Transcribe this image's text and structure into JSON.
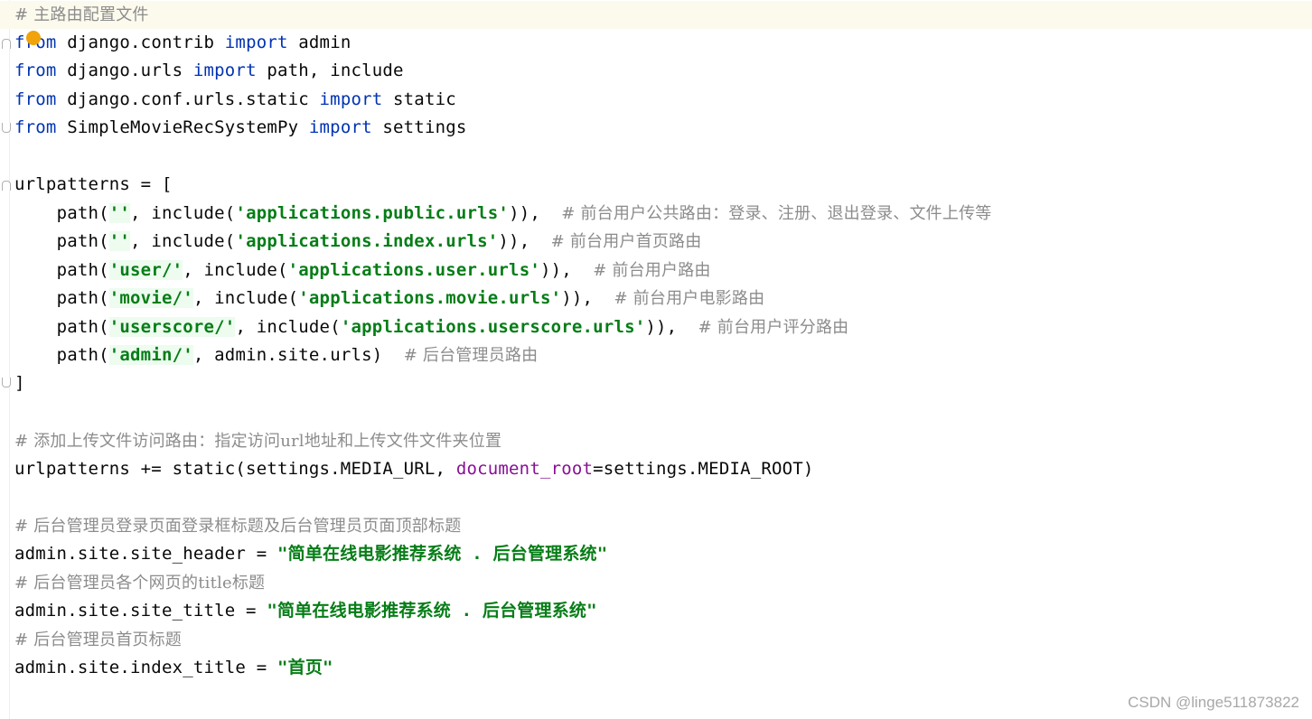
{
  "code": {
    "comment_main": "# 主路由配置文件",
    "imports": [
      {
        "from": "from",
        "module": "django.contrib",
        "import": "import",
        "names": "admin"
      },
      {
        "from": "from",
        "module": "django.urls",
        "import": "import",
        "names": "path, include"
      },
      {
        "from": "from",
        "module": "django.conf.urls.static",
        "import": "import",
        "names": "static"
      },
      {
        "from": "from",
        "module": "SimpleMovieRecSystemPy",
        "import": "import",
        "names": "settings"
      }
    ],
    "urlpatterns_open": "urlpatterns = [",
    "routes": [
      {
        "pre": "path(",
        "route": "''",
        "mid": ", include(",
        "module": "'applications.public.urls'",
        "post": ")),",
        "comment": "# 前台用户公共路由：登录、注册、退出登录、文件上传等"
      },
      {
        "pre": "path(",
        "route": "''",
        "mid": ", include(",
        "module": "'applications.index.urls'",
        "post": ")),",
        "comment": "# 前台用户首页路由"
      },
      {
        "pre": "path(",
        "route": "'user/'",
        "mid": ", include(",
        "module": "'applications.user.urls'",
        "post": ")),",
        "comment": "# 前台用户路由"
      },
      {
        "pre": "path(",
        "route": "'movie/'",
        "mid": ", include(",
        "module": "'applications.movie.urls'",
        "post": ")),",
        "comment": "# 前台用户电影路由"
      },
      {
        "pre": "path(",
        "route": "'userscore/'",
        "mid": ", include(",
        "module": "'applications.userscore.urls'",
        "post": ")),",
        "comment": "# 前台用户评分路由"
      },
      {
        "pre": "path(",
        "route": "'admin/'",
        "mid": ", admin.site.urls)",
        "module": "",
        "post": "",
        "comment": "# 后台管理员路由"
      }
    ],
    "urlpatterns_close": "]",
    "comment_static": "# 添加上传文件访问路由：指定访问url地址和上传文件文件夹位置",
    "static_line": {
      "pre": "urlpatterns += static(settings.MEDIA_URL, ",
      "param": "document_root",
      "post": "=settings.MEDIA_ROOT)"
    },
    "comment_header": "# 后台管理员登录页面登录框标题及后台管理员页面顶部标题",
    "site_header": {
      "pre": "admin.site.site_header = ",
      "value": "\"简单在线电影推荐系统 . 后台管理系统\""
    },
    "comment_title": "# 后台管理员各个网页的title标题",
    "site_title": {
      "pre": "admin.site.site_title = ",
      "value": "\"简单在线电影推荐系统 . 后台管理系统\""
    },
    "comment_index": "# 后台管理员首页标题",
    "index_title": {
      "pre": "admin.site.index_title = ",
      "value": "\"首页\""
    }
  },
  "watermark": "CSDN @linge511873822",
  "colors": {
    "keyword": "#0033b3",
    "string": "#067d17",
    "comment": "#8c8c8c",
    "param": "#871094",
    "current_line": "#fcfaed",
    "bulb": "#f0a30a"
  }
}
